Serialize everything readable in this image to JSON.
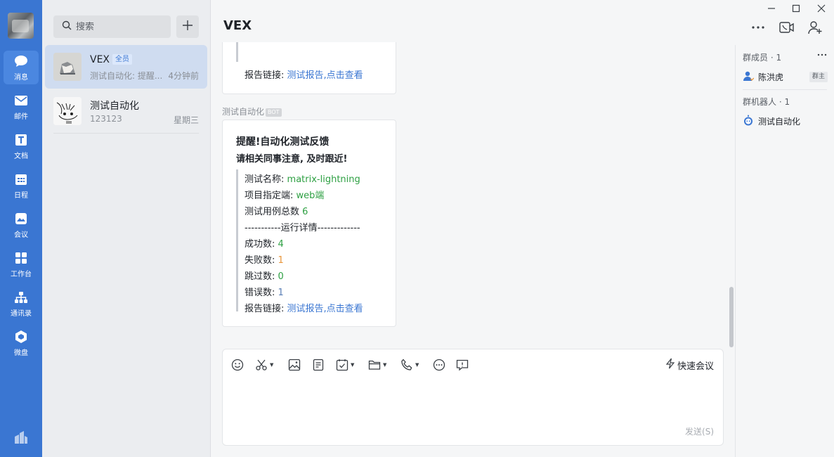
{
  "nav": {
    "items": [
      {
        "label": "消息",
        "icon": "message-icon"
      },
      {
        "label": "邮件",
        "icon": "mail-icon"
      },
      {
        "label": "文档",
        "icon": "document-icon"
      },
      {
        "label": "日程",
        "icon": "calendar-icon"
      },
      {
        "label": "会议",
        "icon": "meeting-icon"
      },
      {
        "label": "工作台",
        "icon": "workbench-icon"
      },
      {
        "label": "通讯录",
        "icon": "contacts-icon"
      },
      {
        "label": "微盘",
        "icon": "drive-icon"
      }
    ]
  },
  "search": {
    "placeholder": "搜索"
  },
  "conversations": [
    {
      "name": "VEX",
      "tag": "全员",
      "preview": "测试自动化: 提醒...",
      "time": "4分钟前"
    },
    {
      "name": "测试自动化",
      "tag": "",
      "preview": "123123",
      "time": "星期三"
    }
  ],
  "chat": {
    "title": "VEX",
    "prev_message": {
      "link_label": "报告链接:",
      "link_text": "测试报告,点击查看"
    },
    "sender": {
      "name": "测试自动化",
      "badge": "BOT"
    },
    "message": {
      "heading": "提醒!自动化测试反馈",
      "subheading": "请相关同事注意, 及时跟近!",
      "name_label": "测试名称:",
      "name_value": "matrix-lightning",
      "platform_label": "项目指定端:",
      "platform_value": "web端",
      "total_label": "测试用例总数",
      "total_value": "6",
      "separator": "-----------运行详情-------------",
      "success_label": "成功数:",
      "success_value": "4",
      "fail_label": "失败数:",
      "fail_value": "1",
      "skip_label": "跳过数:",
      "skip_value": "0",
      "error_label": "错误数:",
      "error_value": "1",
      "link_label": "报告链接:",
      "link_text": "测试报告,点击查看"
    }
  },
  "composer": {
    "quick_meeting": "快速会议",
    "send": "发送(S)",
    "value": ""
  },
  "right_panel": {
    "members_title": "群成员 · 1",
    "members": [
      {
        "name": "陈洪虎",
        "role": "群主"
      }
    ],
    "bots_title": "群机器人 · 1",
    "bots": [
      {
        "name": "测试自动化"
      }
    ]
  }
}
